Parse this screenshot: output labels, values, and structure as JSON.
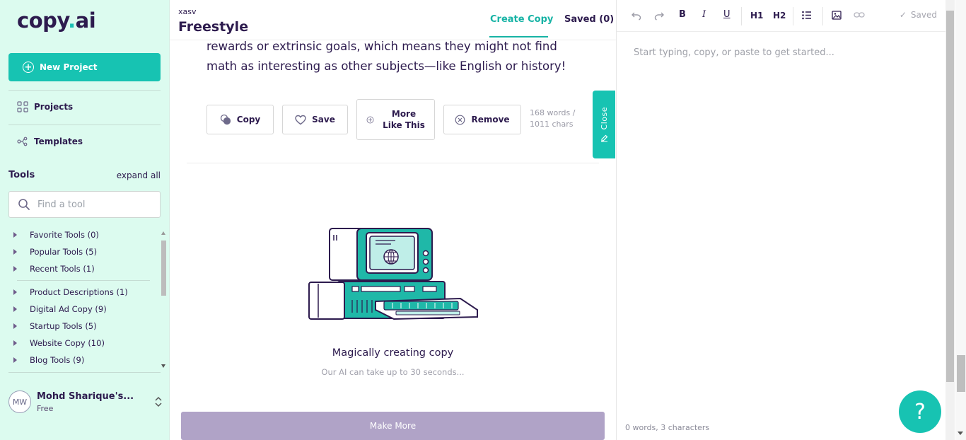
{
  "app": {
    "logo_text_a": "copy",
    "logo_text_dot": ".",
    "logo_text_b": "ai"
  },
  "sidebar": {
    "new_project_label": "New Project",
    "projects_label": "Projects",
    "templates_label": "Templates",
    "tools_title": "Tools",
    "expand_all": "expand all",
    "search_placeholder": "Find a tool",
    "tool_groups_a": [
      {
        "label": "Favorite Tools (0)"
      },
      {
        "label": "Popular Tools (5)"
      },
      {
        "label": "Recent Tools (1)"
      }
    ],
    "tool_groups_b": [
      {
        "label": "Product Descriptions (1)"
      },
      {
        "label": "Digital Ad Copy (9)"
      },
      {
        "label": "Startup Tools (5)"
      },
      {
        "label": "Website Copy (10)"
      },
      {
        "label": "Blog Tools (9)"
      }
    ],
    "user": {
      "initials": "MW",
      "name": "Mohd Sharique's...",
      "plan": "Free"
    }
  },
  "header": {
    "breadcrumb": "xasv",
    "title": "Freestyle",
    "tab_create": "Create Copy",
    "tab_saved": "Saved (0)"
  },
  "result": {
    "text": "rewards or extrinsic goals, which means they might not find math as interesting as other subjects—like English or history!",
    "copy_label": "Copy",
    "save_label": "Save",
    "more_label_1": "More",
    "more_label_2": "Like This",
    "remove_label": "Remove",
    "word_count": "168 words /",
    "char_count": "1011 chars",
    "close_label": "Close"
  },
  "loading": {
    "title": "Magically creating copy",
    "subtitle": "Our AI can take up to 30 seconds..."
  },
  "make_more_label": "Make More",
  "editor": {
    "toolbar": {
      "h1": "H1",
      "h2": "H2",
      "saved": "Saved"
    },
    "placeholder": "Start typing, copy, or paste to get started...",
    "footer": "0 words, 3 characters"
  },
  "help_label": "?",
  "colors": {
    "accent": "#17c3b2",
    "sidebar_bg": "#dcfbef",
    "text_dark": "#2d1b4e",
    "make_more_bg": "#b0a3c7"
  }
}
